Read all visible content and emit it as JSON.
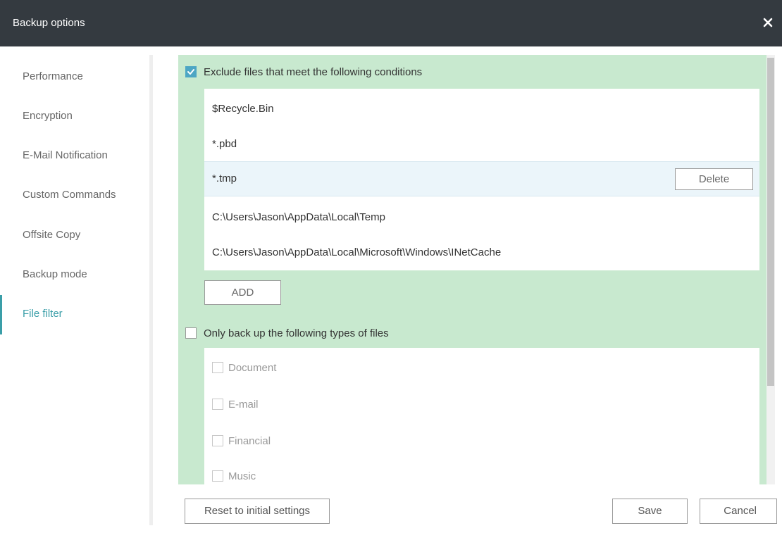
{
  "window": {
    "title": "Backup options",
    "close_icon": "close-icon"
  },
  "sidebar": {
    "items": [
      {
        "label": "Performance"
      },
      {
        "label": "Encryption"
      },
      {
        "label": "E-Mail Notification"
      },
      {
        "label": "Custom Commands"
      },
      {
        "label": "Offsite Copy"
      },
      {
        "label": "Backup mode"
      },
      {
        "label": "File filter",
        "active": true
      }
    ]
  },
  "exclude": {
    "checked": true,
    "label": "Exclude files that meet the following conditions",
    "rows": [
      {
        "value": "$Recycle.Bin"
      },
      {
        "value": "*.pbd"
      },
      {
        "value": "*.tmp",
        "selected": true
      },
      {
        "value": "C:\\Users\\Jason\\AppData\\Local\\Temp"
      },
      {
        "value": "C:\\Users\\Jason\\AppData\\Local\\Microsoft\\Windows\\INetCache"
      }
    ],
    "delete_label": "Delete",
    "add_label": "ADD"
  },
  "only_types": {
    "checked": false,
    "label": "Only back up the following types of files",
    "types": [
      {
        "label": "Document",
        "checked": false
      },
      {
        "label": "E-mail",
        "checked": false
      },
      {
        "label": "Financial",
        "checked": false
      },
      {
        "label": "Music",
        "checked": false
      }
    ]
  },
  "footer": {
    "reset_label": "Reset to initial settings",
    "save_label": "Save",
    "cancel_label": "Cancel"
  },
  "colors": {
    "titlebar": "#343a40",
    "accent": "#3a9ea8",
    "panel_bg": "#c8e9cf",
    "checkbox_checked": "#4da6c4"
  }
}
